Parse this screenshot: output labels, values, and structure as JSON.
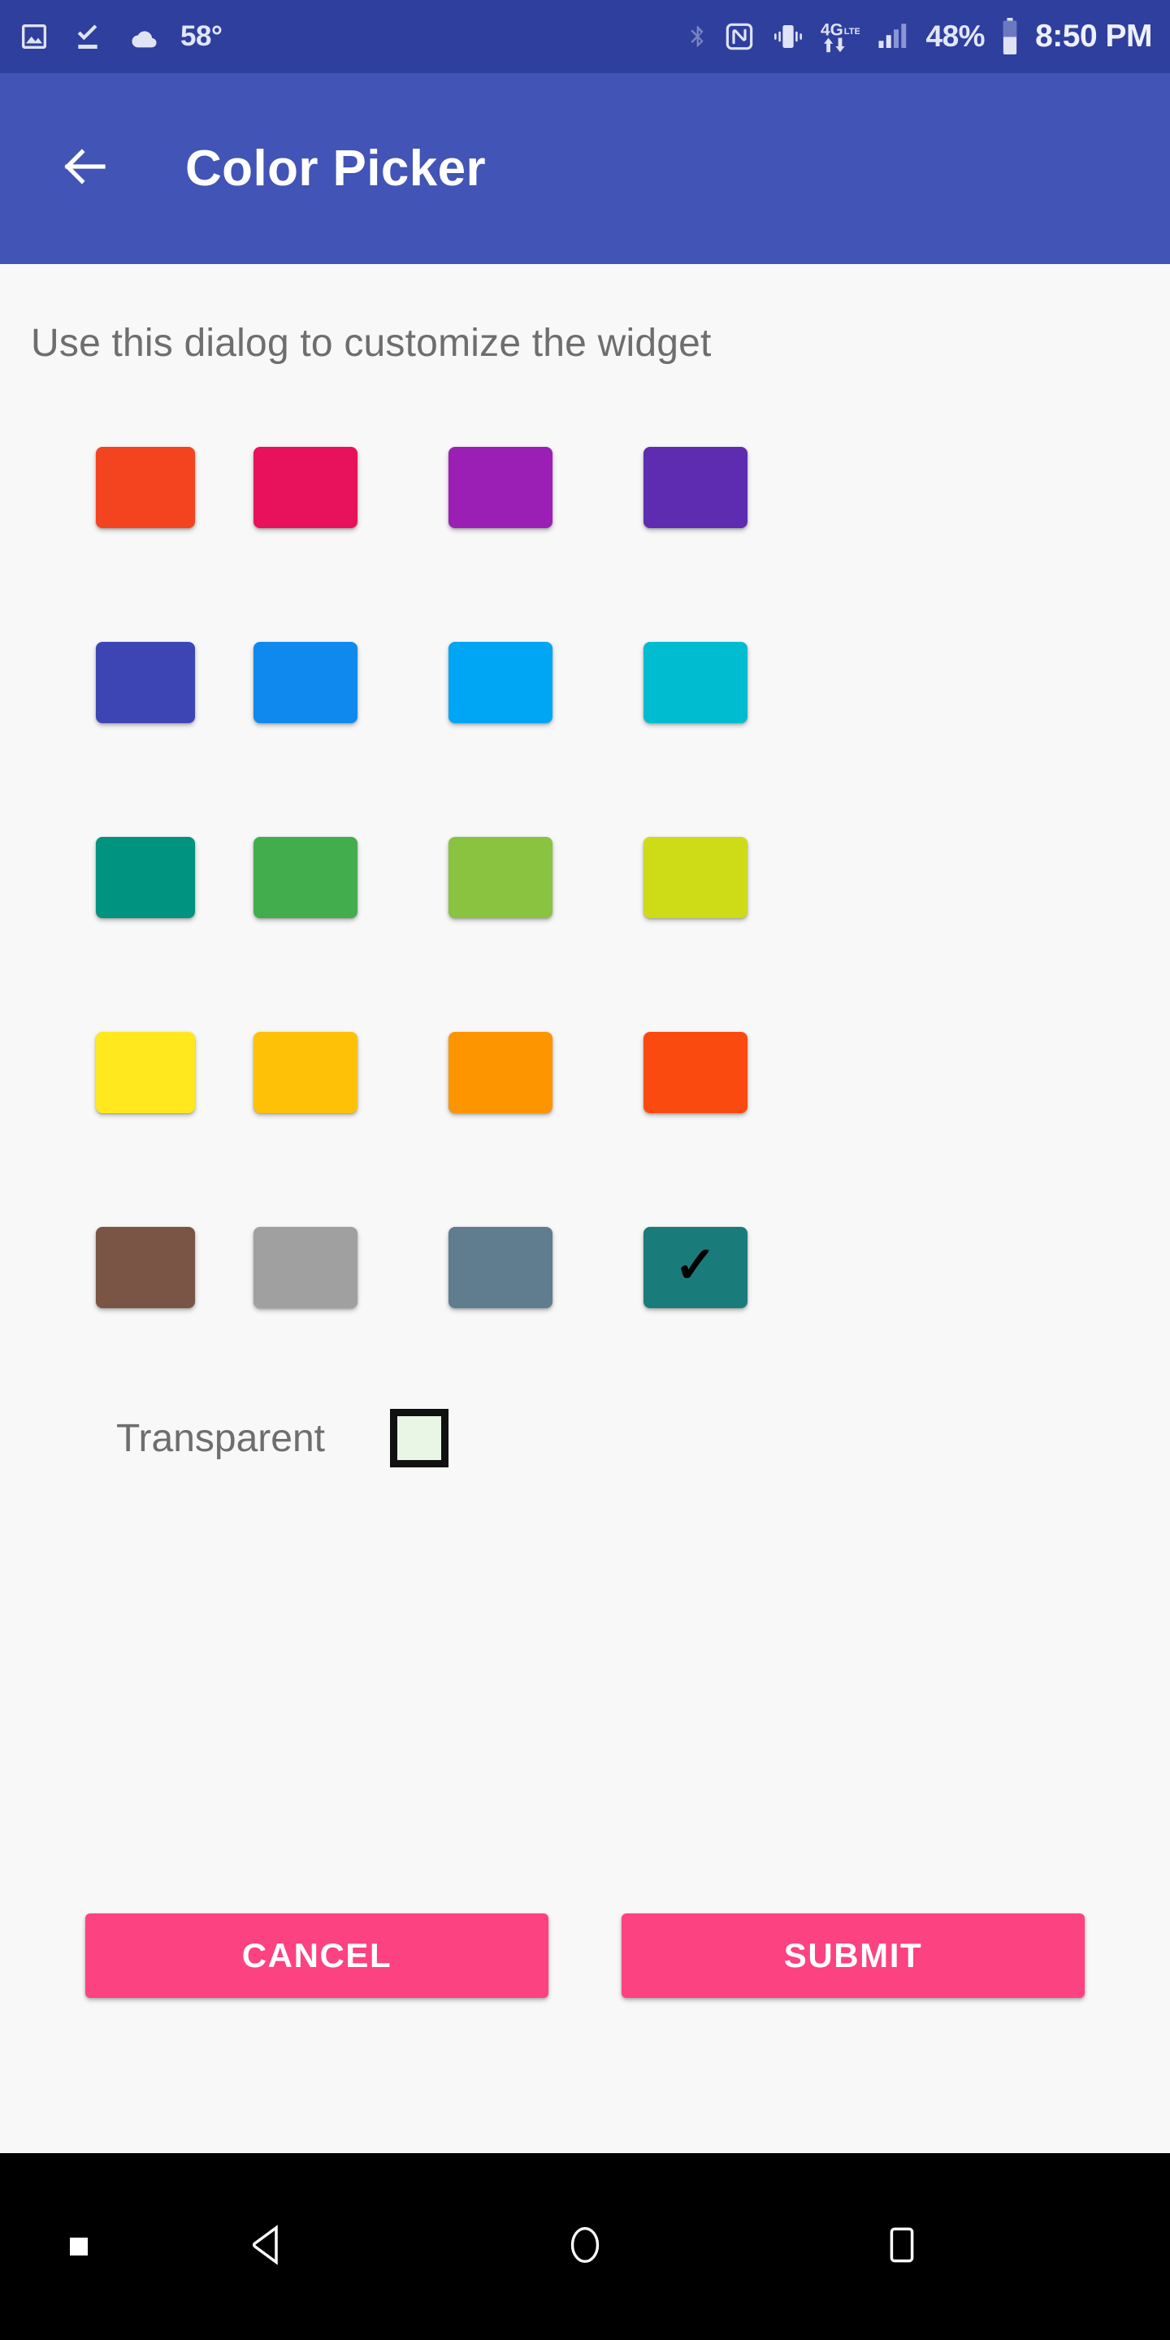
{
  "status_bar": {
    "background": "#2f3f9e",
    "temperature": "58°",
    "battery_percent": "48%",
    "battery_level": 48,
    "clock": "8:50 PM",
    "left_icons": [
      "photo-icon",
      "download-complete-icon",
      "cloud-icon"
    ],
    "right_icons": [
      "bluetooth-icon",
      "nfc-icon",
      "vibrate-icon",
      "4g-lte-icon",
      "signal-bars-icon",
      "battery-icon"
    ],
    "signal_bars_filled": 2,
    "signal_bars_total": 4
  },
  "app_bar": {
    "background": "#4254b5",
    "title": "Color Picker",
    "back_icon": "arrow-left-icon"
  },
  "dialog": {
    "message": "Use this dialog to customize the widget",
    "transparent_label": "Transparent",
    "transparent_checked": false,
    "transparent_box_fill": "#e9f6e6",
    "selected_index": 19,
    "selected_color": "#1a7b7b",
    "check_glyph": "✓",
    "swatch_rows": [
      [
        {
          "name": "red",
          "hex": "#f4431f"
        },
        {
          "name": "pink",
          "hex": "#e8115b"
        },
        {
          "name": "purple",
          "hex": "#9c1fb5"
        },
        {
          "name": "deep-purple",
          "hex": "#5e2cb0"
        }
      ],
      [
        {
          "name": "indigo",
          "hex": "#3d45b5"
        },
        {
          "name": "blue",
          "hex": "#1089ee"
        },
        {
          "name": "light-blue",
          "hex": "#00a5f4"
        },
        {
          "name": "cyan",
          "hex": "#00bcd0"
        }
      ],
      [
        {
          "name": "teal",
          "hex": "#00937f"
        },
        {
          "name": "green",
          "hex": "#42ad4c"
        },
        {
          "name": "light-green",
          "hex": "#89c33f"
        },
        {
          "name": "lime",
          "hex": "#cddc17"
        }
      ],
      [
        {
          "name": "yellow",
          "hex": "#ffe91e"
        },
        {
          "name": "amber",
          "hex": "#ffc107"
        },
        {
          "name": "orange",
          "hex": "#fd9500"
        },
        {
          "name": "deep-orange",
          "hex": "#fb4a10"
        }
      ],
      [
        {
          "name": "brown",
          "hex": "#7a5444"
        },
        {
          "name": "grey",
          "hex": "#a0a0a0"
        },
        {
          "name": "blue-grey",
          "hex": "#5f7d8e"
        },
        {
          "name": "dark-teal",
          "hex": "#1a7b7b"
        }
      ]
    ]
  },
  "buttons": {
    "cancel_label": "CANCEL",
    "submit_label": "SUBMIT",
    "accent": "#fc4281"
  },
  "nav_bar": {
    "background": "#000000",
    "items": [
      "back-nav-icon",
      "home-nav-icon",
      "recents-nav-icon"
    ]
  }
}
